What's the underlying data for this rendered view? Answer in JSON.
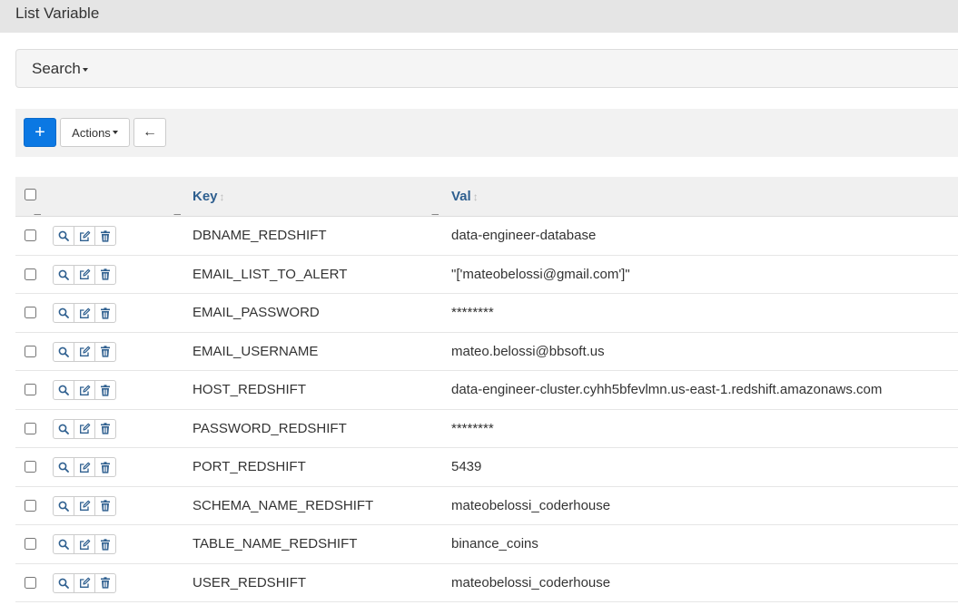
{
  "page": {
    "title": "List Variable"
  },
  "search": {
    "label": "Search"
  },
  "toolbar": {
    "add_label": "+",
    "actions_label": "Actions",
    "back_label": "←"
  },
  "table": {
    "columns": [
      "Key",
      "Val"
    ],
    "rows": [
      {
        "key": "DBNAME_REDSHIFT",
        "val": "data-engineer-database"
      },
      {
        "key": "EMAIL_LIST_TO_ALERT",
        "val": "\"['mateobelossi@gmail.com']\""
      },
      {
        "key": "EMAIL_PASSWORD",
        "val": "********"
      },
      {
        "key": "EMAIL_USERNAME",
        "val": "mateo.belossi@bbsoft.us"
      },
      {
        "key": "HOST_REDSHIFT",
        "val": "data-engineer-cluster.cyhh5bfevlmn.us-east-1.redshift.amazonaws.com"
      },
      {
        "key": "PASSWORD_REDSHIFT",
        "val": "********"
      },
      {
        "key": "PORT_REDSHIFT",
        "val": "5439"
      },
      {
        "key": "SCHEMA_NAME_REDSHIFT",
        "val": "mateobelossi_coderhouse"
      },
      {
        "key": "TABLE_NAME_REDSHIFT",
        "val": "binance_coins"
      },
      {
        "key": "USER_REDSHIFT",
        "val": "mateobelossi_coderhouse"
      }
    ]
  },
  "icons": {
    "row_actions": [
      "search-icon",
      "edit-icon",
      "trash-icon"
    ],
    "sort": "sort-icon"
  },
  "colors": {
    "primary": "#0b78e3",
    "header_link": "#2e5f8f",
    "action_icon": "#2e5f8f"
  }
}
